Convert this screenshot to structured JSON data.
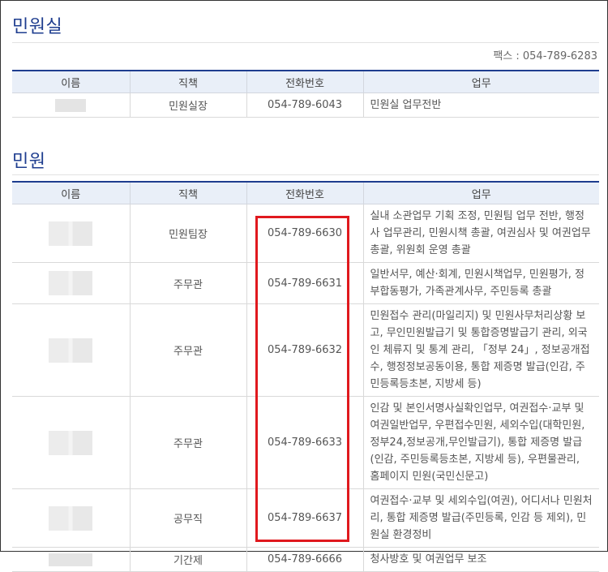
{
  "section1": {
    "title": "민원실",
    "fax": "팩스 : 054-789-6283",
    "headers": [
      "이름",
      "직책",
      "전화번호",
      "업무"
    ],
    "rows": [
      {
        "position": "민원실장",
        "phone": "054-789-6043",
        "duty": "민원실 업무전반"
      }
    ]
  },
  "section2": {
    "title": "민원",
    "headers": [
      "이름",
      "직책",
      "전화번호",
      "업무"
    ],
    "rows": [
      {
        "position": "민원팀장",
        "phone": "054-789-6630",
        "duty": "실내 소관업무 기획 조정, 민원팀 업무 전반, 행정사 업무관리, 민원시책 총괄, 여권심사 및 여권업무 총괄, 위원회 운영 총괄"
      },
      {
        "position": "주무관",
        "phone": "054-789-6631",
        "duty": "일반서무, 예산·회계, 민원시책업무, 민원평가, 정부합동평가, 가족관계사무, 주민등록 총괄"
      },
      {
        "position": "주무관",
        "phone": "054-789-6632",
        "duty": "민원접수 관리(마일리지) 및 민원사무처리상황 보고, 무인민원발급기 및 통합증명발급기 관리, 외국인 체류지 및 통계 관리, 「정부 24」, 정보공개접수, 행정정보공동이용, 통합 제증명 발급(인감, 주민등록등초본, 지방세 등)"
      },
      {
        "position": "주무관",
        "phone": "054-789-6633",
        "duty": "인감 및 본인서명사실확인업무, 여권접수·교부 및 여권일반업무, 우편접수민원, 세외수입(대학민원,정부24,정보공개,무인발급기), 통합 제증명 발급(인감, 주민등록등초본, 지방세 등), 우편물관리, 홈페이지 민원(국민신문고)"
      },
      {
        "position": "공무직",
        "phone": "054-789-6637",
        "duty": "여권접수·교부 및 세외수입(여권), 어디서나 민원처리, 통합 제증명 발급(주민등록, 인감 등 제외), 민원실 환경정비"
      },
      {
        "position": "기간제",
        "phone": "054-789-6666",
        "duty": "청사방호 및 여권업무 보조"
      }
    ]
  },
  "colors": {
    "title": "#1e3d8f",
    "header_bg": "#e9eff8",
    "highlight": "#e0191e"
  }
}
